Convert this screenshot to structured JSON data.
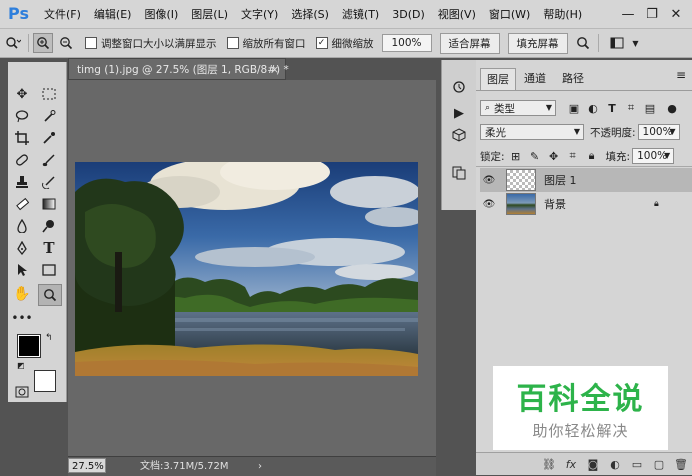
{
  "app": {
    "logo": "Ps"
  },
  "menu": [
    "文件(F)",
    "编辑(E)",
    "图像(I)",
    "图层(L)",
    "文字(Y)",
    "选择(S)",
    "滤镜(T)",
    "3D(D)",
    "视图(V)",
    "窗口(W)",
    "帮助(H)"
  ],
  "window_controls": {
    "minimize": "—",
    "restore": "❐",
    "close": "✕"
  },
  "options": {
    "resize_windows": "调整窗口大小以满屏显示",
    "zoom_all": "缩放所有窗口",
    "scrubby_zoom": "细微缩放",
    "zoom_value": "100%",
    "fit_screen": "适合屏幕",
    "fill_screen": "填充屏幕"
  },
  "document": {
    "tab_title": "timg (1).jpg @ 27.5% (图层 1, RGB/8#) *",
    "close": "×",
    "zoom": "27.5%",
    "doc_info": "文档:3.71M/5.72M",
    "arrow": "›"
  },
  "layers_panel": {
    "tabs": [
      "图层",
      "通道",
      "路径"
    ],
    "menu_icon": "≡",
    "filter_kind": "类型",
    "blend_mode": "柔光",
    "opacity_label": "不透明度:",
    "opacity_value": "100%",
    "lock_label": "锁定:",
    "fill_label": "填充:",
    "fill_value": "100%",
    "layers": [
      {
        "name": "图层 1",
        "selected": true
      },
      {
        "name": "背景",
        "selected": false,
        "locked": true
      }
    ]
  },
  "watermark": {
    "title": "百科全说",
    "subtitle": "助你轻松解决"
  },
  "colors": {
    "foreground": "#000000",
    "background": "#ffffff",
    "accent_green": "#2db34a"
  }
}
